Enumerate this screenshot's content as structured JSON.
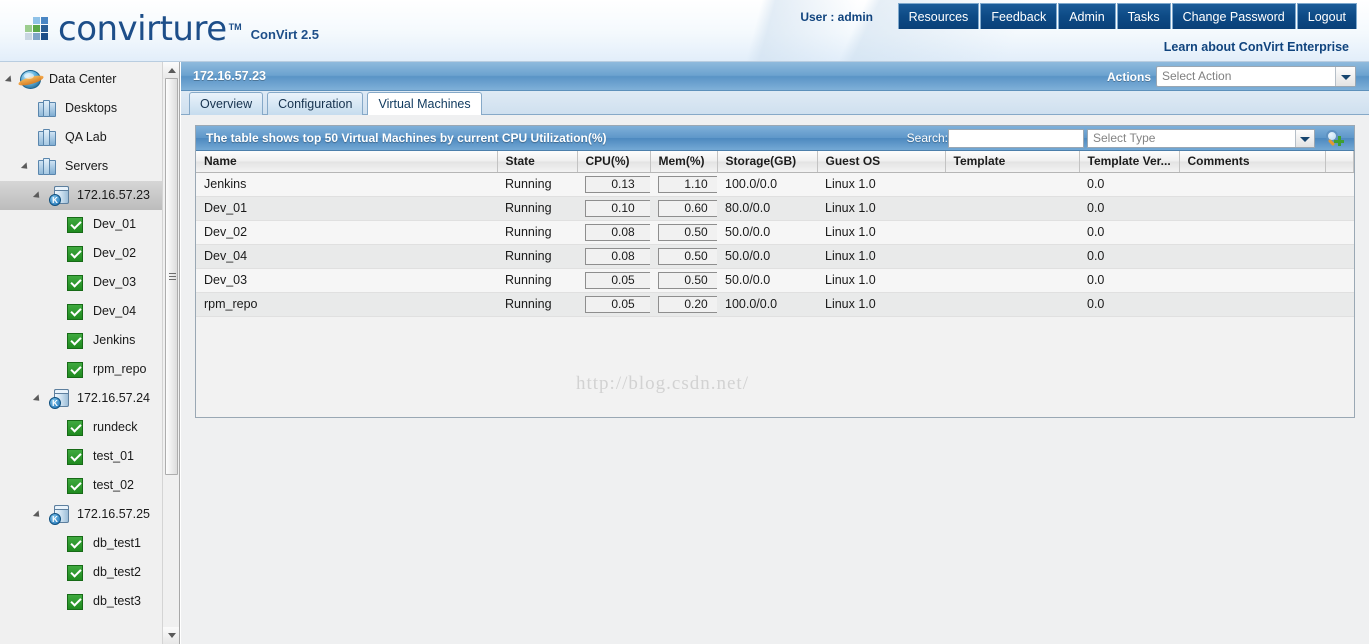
{
  "brand": {
    "name": "convirture",
    "tm": "TM",
    "version_label": "ConVirt 2.5",
    "logo_icon": "convirture-blocks-logo"
  },
  "header": {
    "user_label": "User : admin",
    "enterprise_link": "Learn about ConVirt Enterprise",
    "nav": [
      {
        "label": "Resources",
        "name": "nav-resources"
      },
      {
        "label": "Feedback",
        "name": "nav-feedback"
      },
      {
        "label": "Admin",
        "name": "nav-admin"
      },
      {
        "label": "Tasks",
        "name": "nav-tasks"
      },
      {
        "label": "Change Password",
        "name": "nav-change-password"
      },
      {
        "label": "Logout",
        "name": "nav-logout"
      }
    ],
    "nav_bg": "#0d4a85"
  },
  "sidebar": {
    "items": [
      {
        "label": "Data Center",
        "icon": "globe-icon",
        "indent": 0,
        "twisty": "open",
        "selected": false
      },
      {
        "label": "Desktops",
        "icon": "group-icon",
        "indent": 1,
        "twisty": "none",
        "selected": false
      },
      {
        "label": "QA Lab",
        "icon": "group-icon",
        "indent": 1,
        "twisty": "none",
        "selected": false
      },
      {
        "label": "Servers",
        "icon": "group-icon",
        "indent": 1,
        "twisty": "open",
        "selected": false
      },
      {
        "label": "172.16.57.23",
        "icon": "host-icon",
        "indent": 2,
        "twisty": "open",
        "selected": true
      },
      {
        "label": "Dev_01",
        "icon": "vm-running-icon",
        "indent": 3,
        "twisty": "none",
        "selected": false
      },
      {
        "label": "Dev_02",
        "icon": "vm-running-icon",
        "indent": 3,
        "twisty": "none",
        "selected": false
      },
      {
        "label": "Dev_03",
        "icon": "vm-running-icon",
        "indent": 3,
        "twisty": "none",
        "selected": false
      },
      {
        "label": "Dev_04",
        "icon": "vm-running-icon",
        "indent": 3,
        "twisty": "none",
        "selected": false
      },
      {
        "label": "Jenkins",
        "icon": "vm-running-icon",
        "indent": 3,
        "twisty": "none",
        "selected": false
      },
      {
        "label": "rpm_repo",
        "icon": "vm-running-icon",
        "indent": 3,
        "twisty": "none",
        "selected": false
      },
      {
        "label": "172.16.57.24",
        "icon": "host-icon",
        "indent": 2,
        "twisty": "open",
        "selected": false
      },
      {
        "label": "rundeck",
        "icon": "vm-running-icon",
        "indent": 3,
        "twisty": "none",
        "selected": false
      },
      {
        "label": "test_01",
        "icon": "vm-running-icon",
        "indent": 3,
        "twisty": "none",
        "selected": false
      },
      {
        "label": "test_02",
        "icon": "vm-running-icon",
        "indent": 3,
        "twisty": "none",
        "selected": false
      },
      {
        "label": "172.16.57.25",
        "icon": "host-icon",
        "indent": 2,
        "twisty": "open",
        "selected": false
      },
      {
        "label": "db_test1",
        "icon": "vm-running-icon",
        "indent": 3,
        "twisty": "none",
        "selected": false
      },
      {
        "label": "db_test2",
        "icon": "vm-running-icon",
        "indent": 3,
        "twisty": "none",
        "selected": false
      },
      {
        "label": "db_test3",
        "icon": "vm-running-icon",
        "indent": 3,
        "twisty": "none",
        "selected": false
      }
    ],
    "host_badge_letter": "K"
  },
  "page": {
    "title": "172.16.57.23",
    "actions_label": "Actions",
    "action_select_value": "Select Action",
    "tabs": [
      {
        "label": "Overview",
        "active": false
      },
      {
        "label": "Configuration",
        "active": false
      },
      {
        "label": "Virtual Machines",
        "active": true
      }
    ]
  },
  "grid": {
    "caption": "The table shows top 50 Virtual Machines by current CPU Utilization(%)",
    "search_label": "Search:",
    "search_value": "",
    "search_placeholder": "",
    "type_select_value": "Select Type",
    "search_button_icon": "search-add-icon",
    "columns": [
      "Name",
      "State",
      "CPU(%)",
      "Mem(%)",
      "Storage(GB)",
      "Guest OS",
      "Template",
      "Template Ver...",
      "Comments",
      ""
    ],
    "rows": [
      {
        "name": "Jenkins",
        "state": "Running",
        "cpu": "0.13",
        "mem": "1.10",
        "storage": "100.0/0.0",
        "guest_os": "Linux 1.0",
        "template": "",
        "template_ver": "0.0",
        "comments": ""
      },
      {
        "name": "Dev_01",
        "state": "Running",
        "cpu": "0.10",
        "mem": "0.60",
        "storage": "80.0/0.0",
        "guest_os": "Linux 1.0",
        "template": "",
        "template_ver": "0.0",
        "comments": ""
      },
      {
        "name": "Dev_02",
        "state": "Running",
        "cpu": "0.08",
        "mem": "0.50",
        "storage": "50.0/0.0",
        "guest_os": "Linux 1.0",
        "template": "",
        "template_ver": "0.0",
        "comments": ""
      },
      {
        "name": "Dev_04",
        "state": "Running",
        "cpu": "0.08",
        "mem": "0.50",
        "storage": "50.0/0.0",
        "guest_os": "Linux 1.0",
        "template": "",
        "template_ver": "0.0",
        "comments": ""
      },
      {
        "name": "Dev_03",
        "state": "Running",
        "cpu": "0.05",
        "mem": "0.50",
        "storage": "50.0/0.0",
        "guest_os": "Linux 1.0",
        "template": "",
        "template_ver": "0.0",
        "comments": ""
      },
      {
        "name": "rpm_repo",
        "state": "Running",
        "cpu": "0.05",
        "mem": "0.20",
        "storage": "100.0/0.0",
        "guest_os": "Linux 1.0",
        "template": "",
        "template_ver": "0.0",
        "comments": ""
      }
    ]
  },
  "watermark": "http://blog.csdn.net/"
}
